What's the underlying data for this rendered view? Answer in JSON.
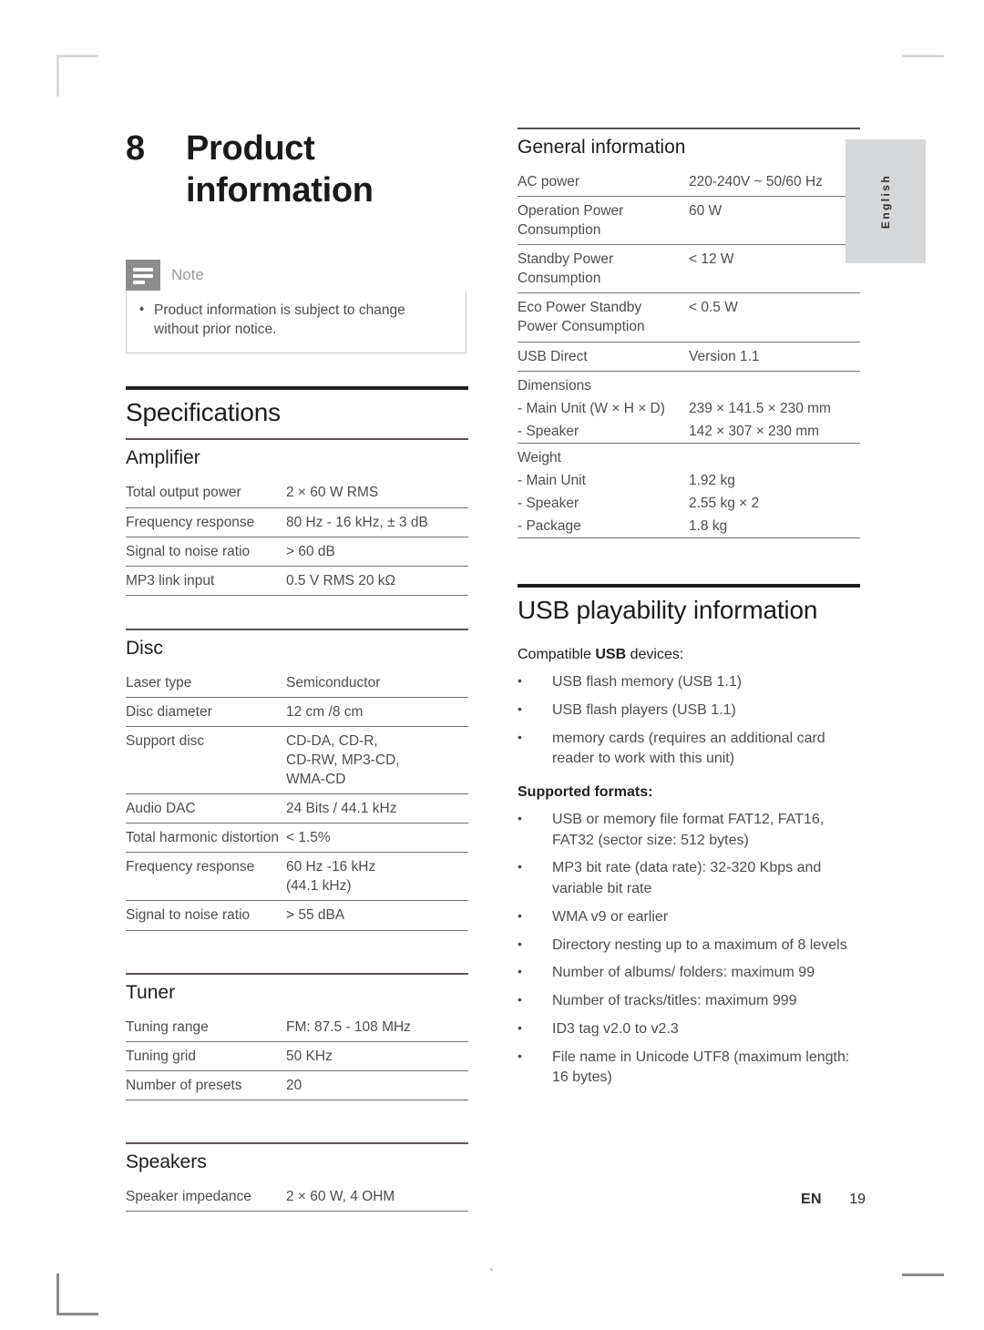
{
  "page": {
    "chapter_number": "8",
    "chapter_title": "Product information",
    "language_tab": "English",
    "footer_locale": "EN",
    "footer_page": "19"
  },
  "note": {
    "label": "Note",
    "bullet": "•",
    "items": [
      "Product information is subject to change without prior notice."
    ]
  },
  "specifications": {
    "heading": "Specifications",
    "sections": [
      {
        "title": "Amplifier",
        "rows": [
          {
            "key": "Total output power",
            "value": "2 × 60 W RMS"
          },
          {
            "key": "Frequency response",
            "value": "80 Hz - 16 kHz, ± 3 dB"
          },
          {
            "key": "Signal to noise ratio",
            "value": "> 60 dB"
          },
          {
            "key": "MP3 link input",
            "value": "0.5 V RMS 20 kΩ"
          }
        ]
      },
      {
        "title": "Disc",
        "rows": [
          {
            "key": "Laser type",
            "value": "Semiconductor"
          },
          {
            "key": "Disc diameter",
            "value": "12 cm /8 cm"
          },
          {
            "key": "Support disc",
            "value": "CD-DA, CD-R,\nCD-RW, MP3-CD,\nWMA-CD"
          },
          {
            "key": "Audio DAC",
            "value": "24 Bits / 44.1 kHz"
          },
          {
            "key": "Total harmonic distortion",
            "value": "< 1.5%"
          },
          {
            "key": "Frequency response",
            "value": "60 Hz -16 kHz\n(44.1 kHz)"
          },
          {
            "key": "Signal to noise ratio",
            "value": "> 55 dBA"
          }
        ]
      },
      {
        "title": "Tuner",
        "rows": [
          {
            "key": "Tuning range",
            "value": "FM: 87.5 - 108 MHz"
          },
          {
            "key": "Tuning grid",
            "value": "50 KHz"
          },
          {
            "key": "Number of presets",
            "value": "20"
          }
        ]
      },
      {
        "title": "Speakers",
        "rows": [
          {
            "key": "Speaker impedance",
            "value": "2 × 60 W, 4 OHM"
          }
        ]
      }
    ]
  },
  "general_information": {
    "title": "General information",
    "rows": [
      {
        "key": "AC power",
        "value": "220-240V ~ 50/60 Hz",
        "rule": true
      },
      {
        "key": "Operation Power Consumption",
        "value": "60 W",
        "rule": true
      },
      {
        "key": "Standby Power Consumption",
        "value": "< 12 W",
        "rule": true
      },
      {
        "key": "Eco Power Standby Power Consumption",
        "value": "< 0.5 W",
        "rule": true
      },
      {
        "key": "USB Direct",
        "value": "Version 1.1",
        "rule": true
      },
      {
        "key": "Dimensions",
        "value": "",
        "rule": true,
        "group": true
      },
      {
        "key": "- Main Unit (W × H × D)",
        "value": "239 × 141.5 × 230 mm",
        "rule": false
      },
      {
        "key": "- Speaker",
        "value": "142 × 307 × 230 mm",
        "rule": false
      },
      {
        "key": "Weight",
        "value": "",
        "rule": true,
        "group": true
      },
      {
        "key": "- Main Unit",
        "value": "1.92 kg",
        "rule": false
      },
      {
        "key": "- Speaker",
        "value": "2.55 kg × 2",
        "rule": false
      },
      {
        "key": "- Package",
        "value": "1.8 kg",
        "rule": false
      }
    ]
  },
  "usb_playability": {
    "heading": "USB playability information",
    "bullet": "•",
    "groups": [
      {
        "label_pre": "Compatible ",
        "label_strong": "USB",
        "label_post": " devices:",
        "items": [
          "USB flash memory (USB 1.1)",
          "USB flash players (USB 1.1)",
          "memory cards (requires an additional card reader to work with this unit)"
        ]
      },
      {
        "label_pre": "Supported formats:",
        "label_strong": "",
        "label_post": "",
        "items": [
          "USB or memory file format FAT12, FAT16, FAT32 (sector size: 512 bytes)",
          "MP3 bit rate (data rate): 32-320 Kbps and variable bit rate",
          "WMA v9 or earlier",
          "Directory nesting up to a maximum of 8 levels",
          "Number of albums/ folders: maximum 99",
          "Number of tracks/titles: maximum 999",
          "ID3 tag v2.0 to v2.3",
          "File name in Unicode UTF8 (maximum length: 16 bytes)"
        ]
      }
    ]
  }
}
